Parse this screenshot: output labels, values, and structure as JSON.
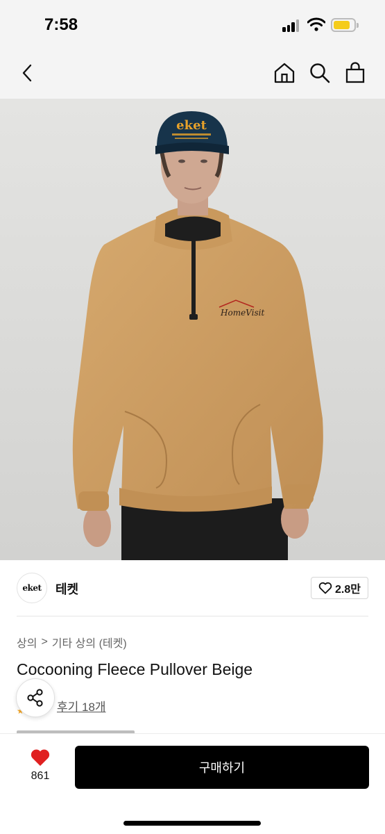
{
  "status_bar": {
    "time": "7:58"
  },
  "nav": {
    "back_icon": "chevron-left-icon",
    "home_icon": "home-icon",
    "search_icon": "search-icon",
    "bag_icon": "shopping-bag-icon"
  },
  "product_image": {
    "cap_text": "eket",
    "chest_text": "HomeVisit"
  },
  "brand": {
    "logo_text": "eket",
    "name": "테켓",
    "likes": "2.8만"
  },
  "breadcrumb": {
    "category": "상의",
    "separator": ">",
    "subcategory": "기타 상의 (테켓)"
  },
  "product": {
    "title": "Cocooning Fleece Pullover Beige",
    "reviews": "후기 18개"
  },
  "bottom_bar": {
    "like_count": "861",
    "buy_label": "구매하기"
  },
  "colors": {
    "accent_red": "#e02020",
    "buy_button": "#000000",
    "star": "#f5a623"
  }
}
